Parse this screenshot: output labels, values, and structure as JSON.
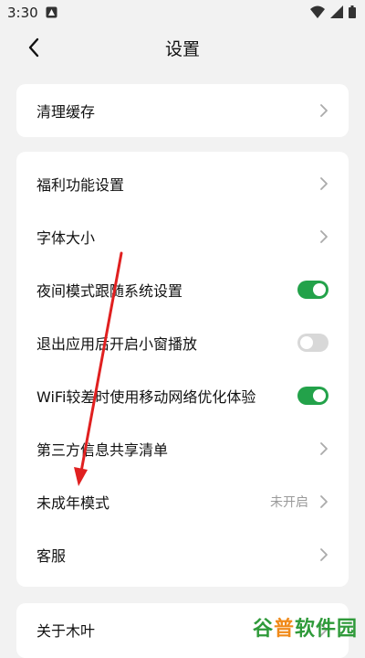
{
  "status_bar": {
    "time": "3:30",
    "icons": [
      "notification-icon",
      "wifi-icon",
      "signal-icon",
      "battery-icon"
    ]
  },
  "header": {
    "title": "设置",
    "back_icon": "chevron-left-icon"
  },
  "groups": [
    {
      "items": [
        {
          "label": "清理缓存",
          "control": "chevron"
        }
      ]
    },
    {
      "items": [
        {
          "label": "福利功能设置",
          "control": "chevron"
        },
        {
          "label": "字体大小",
          "control": "chevron"
        },
        {
          "label": "夜间模式跟随系统设置",
          "control": "toggle",
          "checked": true
        },
        {
          "label": "退出应用后开启小窗播放",
          "control": "toggle",
          "checked": false
        },
        {
          "label": "WiFi较差时使用移动网络优化体验",
          "control": "toggle",
          "checked": true
        },
        {
          "label": "第三方信息共享清单",
          "control": "chevron"
        },
        {
          "label": "未成年模式",
          "control": "chevron",
          "value": "未开启"
        },
        {
          "label": "客服",
          "control": "chevron"
        }
      ]
    },
    {
      "items": [
        {
          "label": "关于木叶",
          "control": "chevron"
        }
      ]
    }
  ],
  "annotation": {
    "type": "arrow",
    "color": "#e02020",
    "points_to": "未成年模式"
  },
  "watermark": {
    "part1": "谷",
    "part2": "普",
    "part3": "软件园"
  },
  "colors": {
    "toggle_on": "#23a24a",
    "toggle_off": "#d8d8d8",
    "background": "#f2f2f2",
    "card": "#ffffff",
    "value_text": "#9a9a9a"
  }
}
